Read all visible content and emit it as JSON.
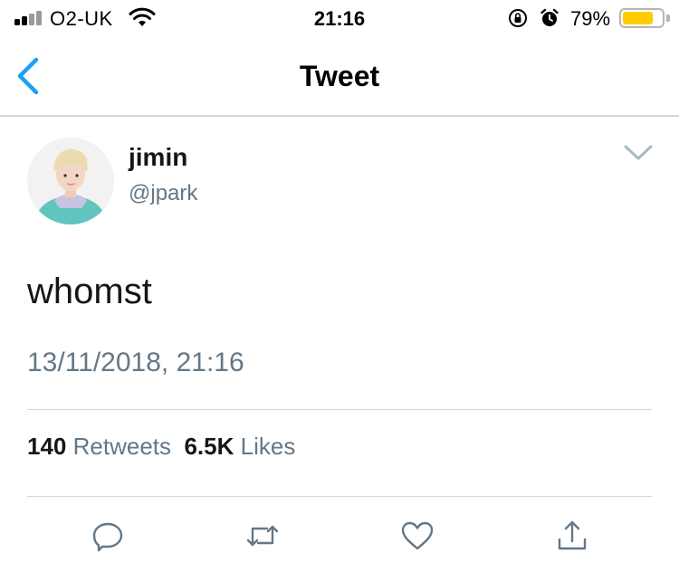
{
  "status_bar": {
    "carrier": "O2-UK",
    "time": "21:16",
    "battery_percent_label": "79%",
    "battery_level": 0.79,
    "battery_color": "#ffcc00"
  },
  "nav": {
    "title": "Tweet",
    "back_icon": "chevron-left-icon",
    "accent_color": "#1da1f2"
  },
  "tweet": {
    "display_name": "jimin",
    "handle": "@jpark",
    "text": "whomst",
    "timestamp": "13/11/2018, 21:16",
    "retweets_count": "140",
    "retweets_label": "Retweets",
    "likes_count": "6.5K",
    "likes_label": "Likes"
  },
  "actions": [
    {
      "name": "reply",
      "icon": "reply-icon"
    },
    {
      "name": "retweet",
      "icon": "retweet-icon"
    },
    {
      "name": "like",
      "icon": "heart-icon"
    },
    {
      "name": "share",
      "icon": "share-icon"
    }
  ],
  "colors": {
    "text_primary": "#14171a",
    "text_secondary": "#657786",
    "icon_gray": "#657786",
    "divider": "#d6d6d6"
  }
}
